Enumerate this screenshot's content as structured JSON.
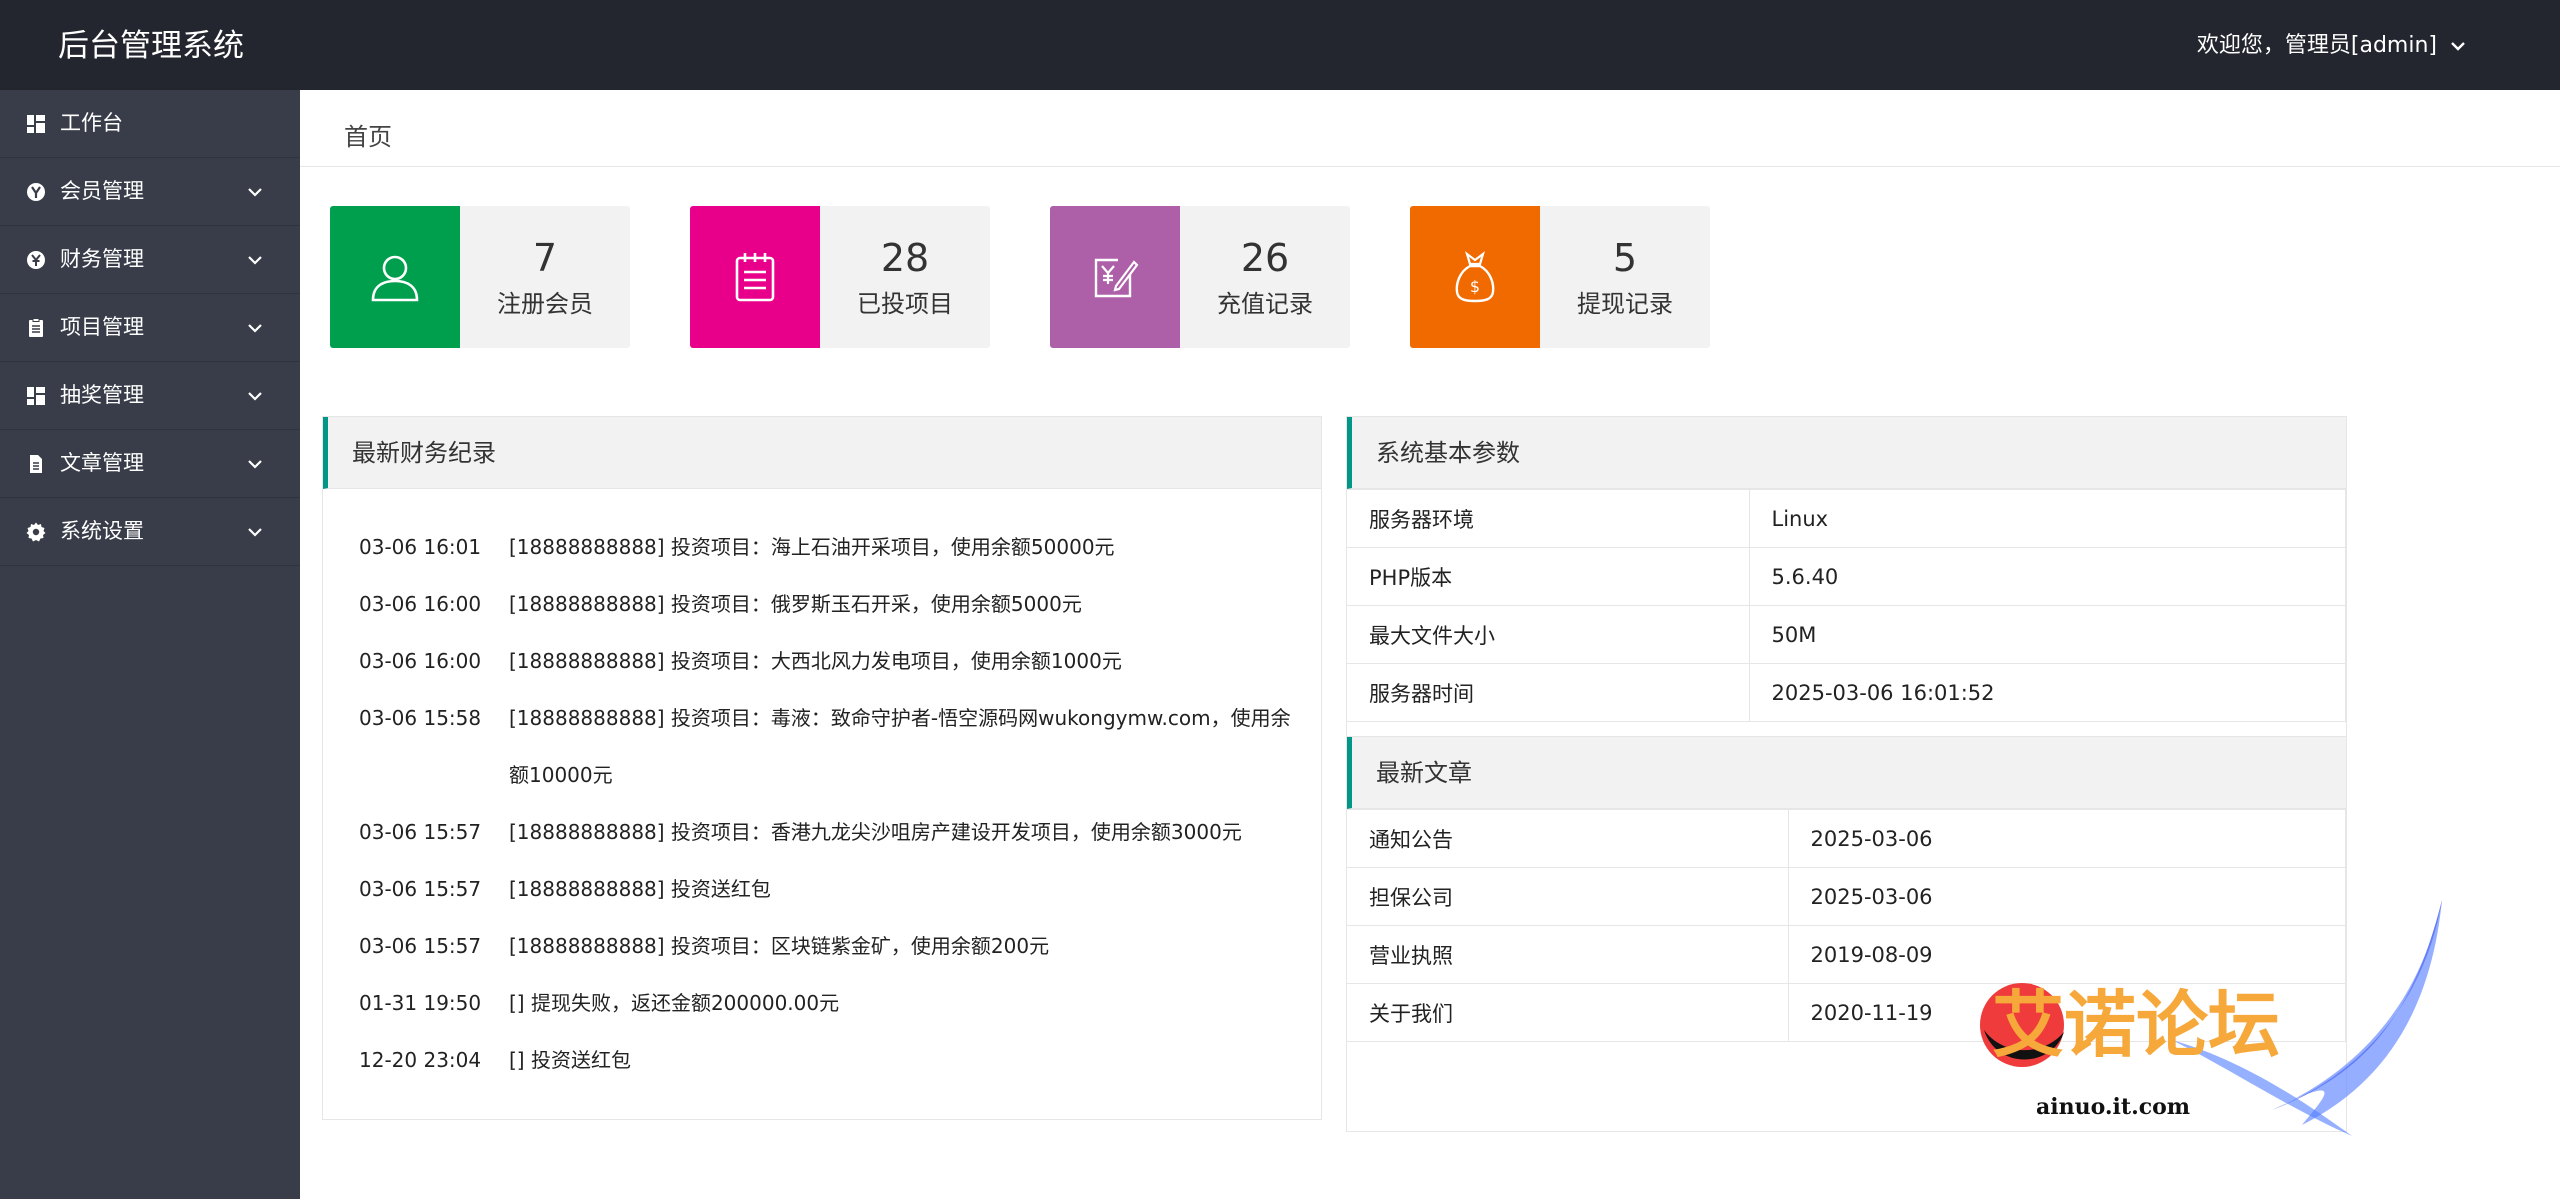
{
  "header": {
    "title": "后台管理系统",
    "user_menu": "欢迎您，管理员[admin]"
  },
  "sidebar": {
    "items": [
      {
        "label": "工作台",
        "icon": "dashboard-icon"
      },
      {
        "label": "会员管理",
        "icon": "vip-icon"
      },
      {
        "label": "财务管理",
        "icon": "yen-icon"
      },
      {
        "label": "项目管理",
        "icon": "clipboard-icon"
      },
      {
        "label": "抽奖管理",
        "icon": "dashboard-icon"
      },
      {
        "label": "文章管理",
        "icon": "document-icon"
      },
      {
        "label": "系统设置",
        "icon": "gear-icon"
      }
    ]
  },
  "breadcrumb": "首页",
  "stats": [
    {
      "value": "7",
      "label": "注册会员",
      "color": "#009f4d",
      "icon": "user-icon"
    },
    {
      "value": "28",
      "label": "已投项目",
      "color": "#e8008a",
      "icon": "notepad-icon"
    },
    {
      "value": "26",
      "label": "充值记录",
      "color": "#ad5fa8",
      "icon": "recharge-icon"
    },
    {
      "value": "5",
      "label": "提现记录",
      "color": "#f06a00",
      "icon": "money-bag-icon"
    }
  ],
  "finance": {
    "title": "最新财务纪录",
    "logs": [
      {
        "time": "03-06 16:01",
        "text": "[18888888888] 投资项目：海上石油开采项目，使用余额50000元"
      },
      {
        "time": "03-06 16:00",
        "text": "[18888888888] 投资项目：俄罗斯玉石开采，使用余额5000元"
      },
      {
        "time": "03-06 16:00",
        "text": "[18888888888] 投资项目：大西北风力发电项目，使用余额1000元"
      },
      {
        "time": "03-06 15:58",
        "text": "[18888888888] 投资项目：毒液：致命守护者-悟空源码网wukongymw.com，使用余额10000元"
      },
      {
        "time": "03-06 15:57",
        "text": "[18888888888] 投资项目：香港九龙尖沙咀房产建设开发项目，使用余额3000元"
      },
      {
        "time": "03-06 15:57",
        "text": "[18888888888] 投资送红包"
      },
      {
        "time": "03-06 15:57",
        "text": "[18888888888] 投资项目：区块链紫金矿，使用余额200元"
      },
      {
        "time": "01-31 19:50",
        "text": "[] 提现失败，返还金额200000.00元"
      },
      {
        "time": "12-20 23:04",
        "text": "[] 投资送红包"
      }
    ]
  },
  "system": {
    "title": "系统基本参数",
    "rows": [
      {
        "k": "服务器环境",
        "v": "Linux"
      },
      {
        "k": "PHP版本",
        "v": "5.6.40"
      },
      {
        "k": "最大文件大小",
        "v": "50M"
      },
      {
        "k": "服务器时间",
        "v": "2025-03-06 16:01:52"
      }
    ]
  },
  "articles": {
    "title": "最新文章",
    "rows": [
      {
        "k": "通知公告",
        "v": "2025-03-06"
      },
      {
        "k": "担保公司",
        "v": "2025-03-06"
      },
      {
        "k": "营业执照",
        "v": "2019-08-09"
      },
      {
        "k": "关于我们",
        "v": "2020-11-19"
      }
    ]
  },
  "watermark": {
    "text": "艾诺论坛",
    "url_text": "ainuo.it.com"
  }
}
